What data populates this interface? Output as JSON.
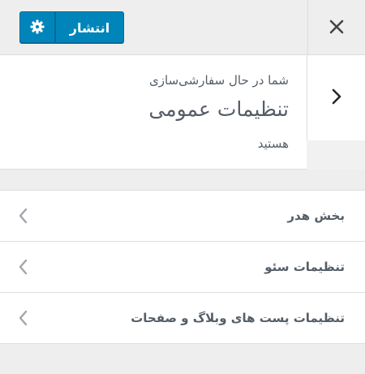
{
  "header": {
    "publish_label": "انتشار",
    "settings_icon": "gear-icon",
    "close_icon": "close-icon"
  },
  "info": {
    "small_text": "شما در حال سفارشی‌سازی",
    "title": "تنظیمات عمومی",
    "tail_text": "هستید",
    "back_icon": "chevron-right-icon"
  },
  "sections": [
    {
      "label": "بخش هدر"
    },
    {
      "label": "تنظیمات سئو"
    },
    {
      "label": "تنظیمات پست های وبلاگ و صفحات"
    }
  ],
  "colors": {
    "accent": "#0085ba",
    "text": "#555d66"
  }
}
